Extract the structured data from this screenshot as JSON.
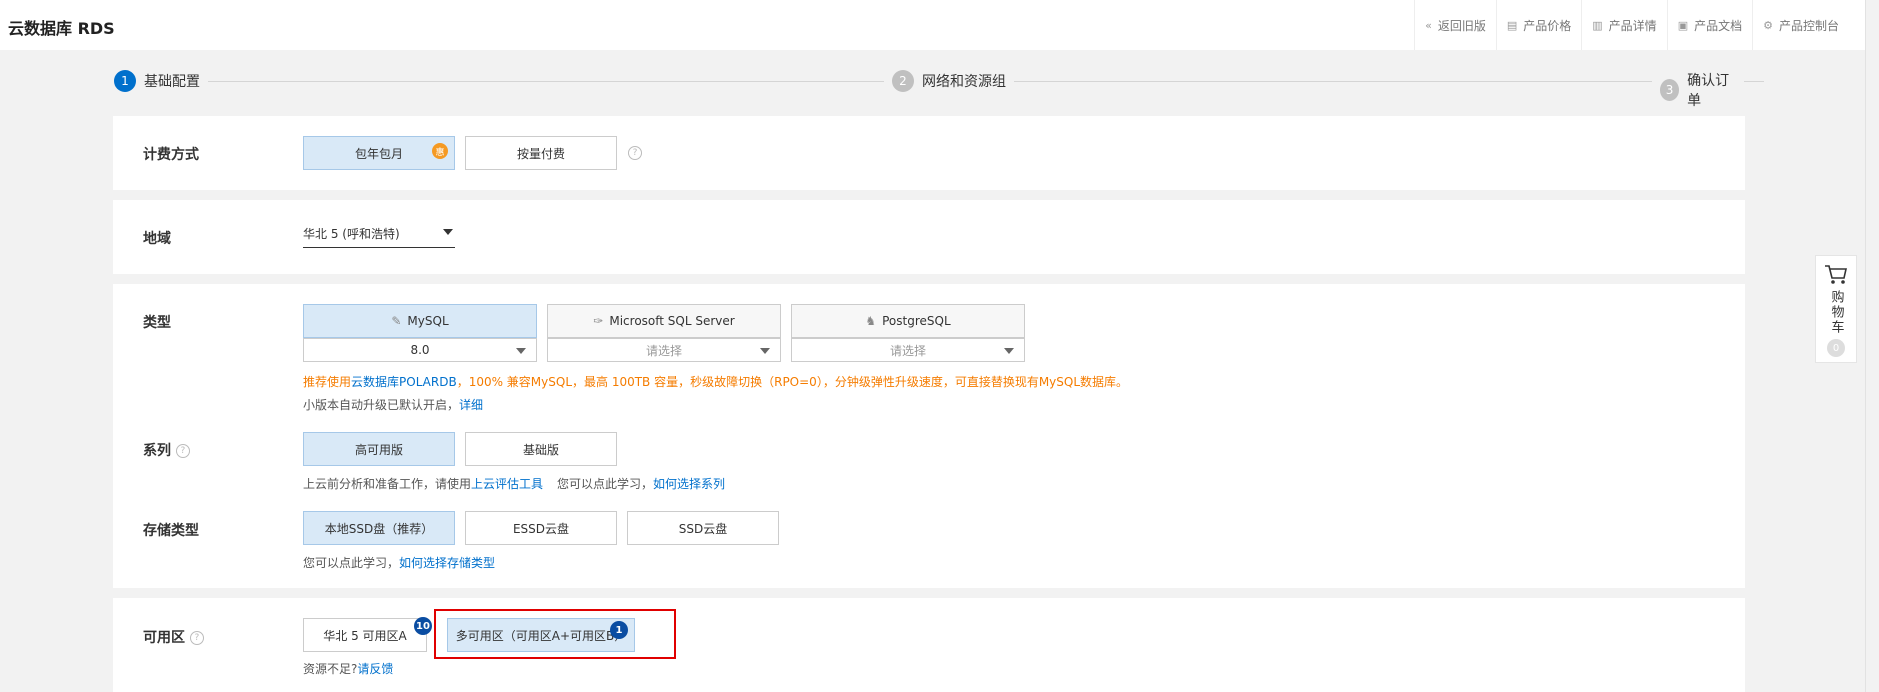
{
  "header": {
    "title": "云数据库 RDS",
    "nav": [
      {
        "icon": "double-left-icon",
        "glyph": "«",
        "label": "返回旧版"
      },
      {
        "icon": "price-icon",
        "glyph": "▤",
        "label": "产品价格"
      },
      {
        "icon": "detail-icon",
        "glyph": "▥",
        "label": "产品详情"
      },
      {
        "icon": "doc-icon",
        "glyph": "▣",
        "label": "产品文档"
      },
      {
        "icon": "console-icon",
        "glyph": "⚙",
        "label": "产品控制台"
      }
    ]
  },
  "steps": [
    {
      "num": "1",
      "label": "基础配置"
    },
    {
      "num": "2",
      "label": "网络和资源组"
    },
    {
      "num": "3",
      "label": "确认订单"
    }
  ],
  "billing": {
    "label": "计费方式",
    "options": [
      "包年包月",
      "按量付费"
    ],
    "selected": "包年包月",
    "badge": "惠",
    "help": "?"
  },
  "region": {
    "label": "地域",
    "value": "华北 5 (呼和浩特)"
  },
  "type": {
    "label": "类型",
    "engines": [
      {
        "name": "MySQL",
        "icon": "mysql-icon",
        "glyph": "✎",
        "version": "8.0"
      },
      {
        "name": "Microsoft SQL Server",
        "icon": "sqlserver-icon",
        "glyph": "✑",
        "version": "请选择"
      },
      {
        "name": "PostgreSQL",
        "icon": "postgresql-icon",
        "glyph": "♞",
        "version": "请选择"
      }
    ],
    "warn_prefix": "推荐使用",
    "warn_link": "云数据库POLARDB",
    "warn_suffix": "，100% 兼容MySQL，最高 100TB 容量，秒级故障切换（RPO=0），分钟级弹性升级速度，可直接替换现有MySQL数据库。",
    "upgrade_text": "小版本自动升级已默认开启，",
    "upgrade_link": "详细"
  },
  "series": {
    "label": "系列",
    "help": "?",
    "options": [
      "高可用版",
      "基础版"
    ],
    "hint_prefix": "上云前分析和准备工作，请使用",
    "hint_link1": "上云评估工具",
    "hint_mid": "您可以点此学习，",
    "hint_link2": "如何选择系列"
  },
  "storage": {
    "label": "存储类型",
    "options": [
      "本地SSD盘（推荐）",
      "ESSD云盘",
      "SSD云盘"
    ],
    "hint_prefix": "您可以点此学习，",
    "hint_link": "如何选择存储类型"
  },
  "zone": {
    "label": "可用区",
    "help": "?",
    "options": [
      {
        "label": "华北 5 可用区A",
        "badge": "10"
      },
      {
        "label": "多可用区（可用区A+可用区B）",
        "badge": "1"
      }
    ],
    "hint_prefix": "资源不足?",
    "hint_link": "请反馈"
  },
  "cart": {
    "label": "购物车",
    "count": "0"
  }
}
